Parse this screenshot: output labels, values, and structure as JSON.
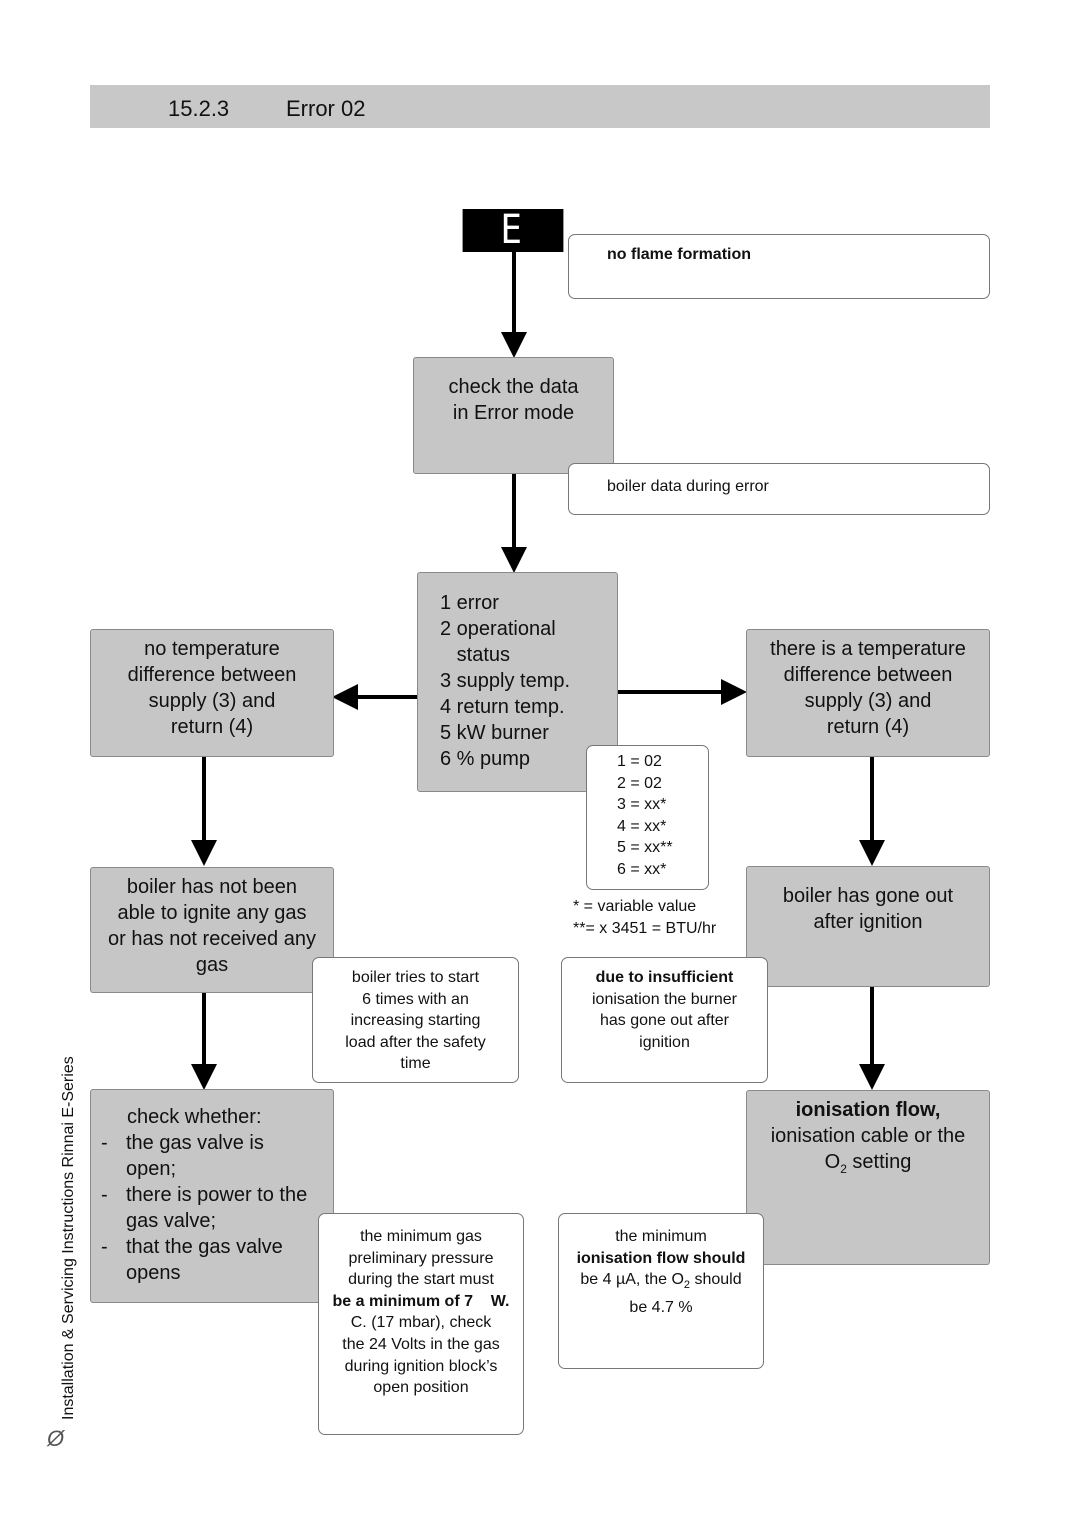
{
  "header": {
    "section": "15.2.3",
    "title": "Error 02"
  },
  "display": {
    "code": "E 02"
  },
  "notes": {
    "no_flame": "no flame formation",
    "boiler_data": "boiler data during error",
    "tries": [
      "boiler tries to start",
      "6 times with an",
      "increasing starting",
      "load after the safety",
      "time"
    ],
    "insufficient_bold": "due to insufficient",
    "insufficient": [
      "ionisation the burner",
      "has gone out after",
      "ignition"
    ],
    "gas_pressure": [
      "the minimum gas",
      "preliminary pressure",
      "during the start must"
    ],
    "gas_pressure_bold": "be a minimum of 7    W.",
    "gas_pressure_rest": [
      "C. (17 mbar), check",
      "the 24 Volts in the gas",
      "during ignition block’s",
      "open position"
    ],
    "ion_min": "the minimum",
    "ion_min_bold": "ionisation flow should",
    "ion_min_rest1": "be 4 µA, the O",
    "ion_min_sub": "2",
    "ion_min_rest2": " should",
    "ion_min_rest3": "be 4.7 %"
  },
  "boxes": {
    "check_data": [
      "check the data",
      "in Error mode"
    ],
    "list": [
      "1 error",
      "2 operational",
      "   status",
      "3 supply temp.",
      "4 return temp.",
      "5 kW burner",
      "6 % pump"
    ],
    "values": [
      "1 = 02",
      "2 = 02",
      "3 = xx*",
      "4 = xx*",
      "5 = xx**",
      "6 = xx*"
    ],
    "footnotes": [
      "* = variable value",
      "**= x 3451 = BTU/hr"
    ],
    "no_temp": [
      "no temperature",
      "difference between",
      "supply (3) and",
      "return (4)"
    ],
    "temp": [
      "there is a temperature",
      "difference between",
      "supply (3) and",
      "return (4)"
    ],
    "not_ignite": [
      "boiler has not been",
      "able to ignite any gas",
      "or has not received any",
      "gas"
    ],
    "gone_out": [
      "boiler has gone out",
      "after ignition"
    ],
    "check_whether": {
      "title": "check whether:",
      "items": [
        {
          "dash": "-",
          "text": "the gas valve is"
        },
        {
          "dash": "",
          "text": "open;"
        },
        {
          "dash": "-",
          "text": "there is power to the"
        },
        {
          "dash": "",
          "text": "gas valve;"
        },
        {
          "dash": "-",
          "text": "that the gas valve"
        },
        {
          "dash": "",
          "text": "opens"
        }
      ]
    },
    "ionisation_bold": "ionisation flow,",
    "ionisation": "ionisation cable or the",
    "ionisation_o": "O",
    "ionisation_sub": "2",
    "ionisation_end": " setting"
  },
  "sidebar": {
    "text": "Installation & Servicing Instructions Rinnai E-Series",
    "logo": "Ø"
  }
}
